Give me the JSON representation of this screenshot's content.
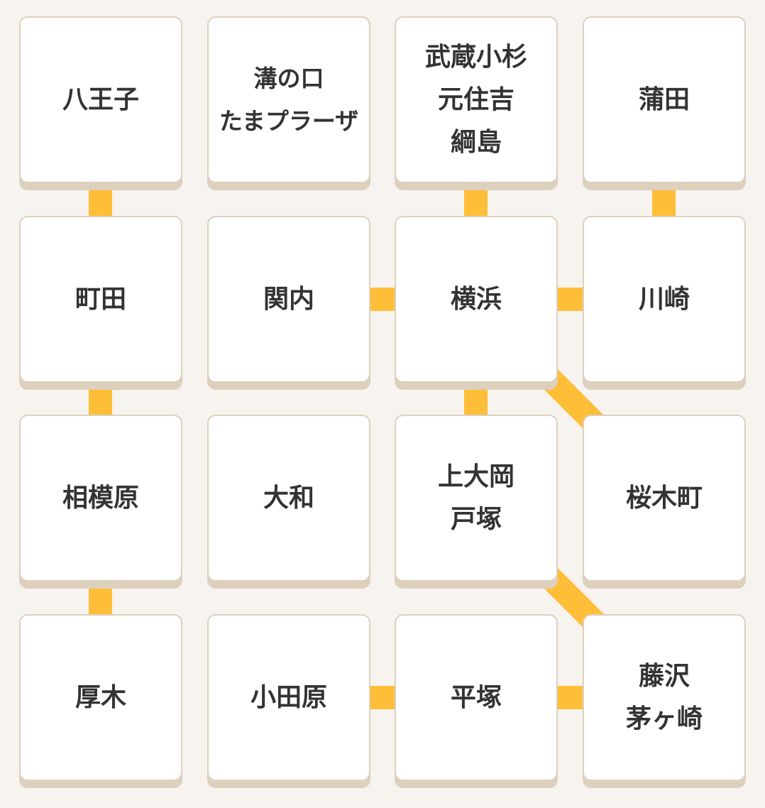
{
  "accent_color": "#ffbe38",
  "stations": [
    [
      "八王子",
      "溝の口\nたまプラーザ",
      "武蔵小杉\n元住吉\n綱島",
      "蒲田"
    ],
    [
      "町田",
      "関内",
      "横浜",
      "川崎"
    ],
    [
      "相模原",
      "大和",
      "上大岡\n戸塚",
      "桜木町"
    ],
    [
      "厚木",
      "小田原",
      "平塚",
      "藤沢\n茅ヶ崎"
    ]
  ]
}
